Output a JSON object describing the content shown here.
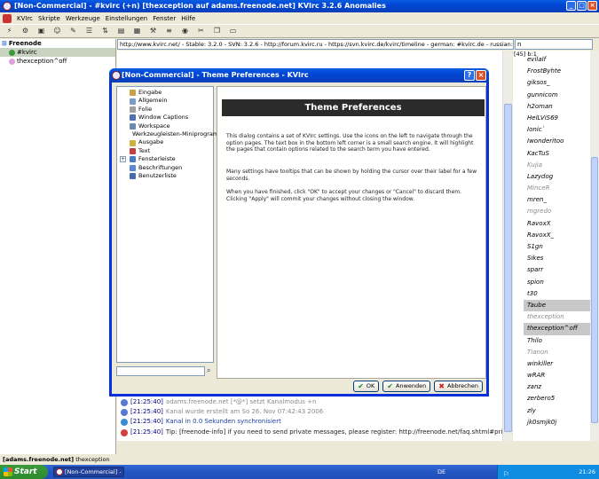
{
  "window": {
    "title": "[Non-Commercial] - #kvirc (+n) [thexception auf adams.freenode.net] KVIrc 3.2.6 Anomalies",
    "controls": [
      "_",
      "□",
      "×"
    ]
  },
  "menu": [
    "KVIrc",
    "Skripte",
    "Werkzeuge",
    "Einstellungen",
    "Fenster",
    "Hilfe"
  ],
  "tree": {
    "network": "Freenode",
    "channel": "#kvirc",
    "query": "thexception^off"
  },
  "topic": "http://www.kvirc.net/ - Stable: 3.2.0 - SVN: 3.2.6 - http://forum.kvirc.ru - https://svn.kvirc.de/kvirc/timeline - german: #kvirc.de - russian: #kvirc-ru - ital",
  "mode_field": "n",
  "user_count": "[45]",
  "user_count_suffix": "b:1",
  "users": [
    {
      "name": "evilalf",
      "style": "normal"
    },
    {
      "name": "FrostByhte",
      "style": "normal"
    },
    {
      "name": "giksos_",
      "style": "normal"
    },
    {
      "name": "gunnicom",
      "style": "normal"
    },
    {
      "name": "h2oman",
      "style": "normal"
    },
    {
      "name": "HelLViS69",
      "style": "normal"
    },
    {
      "name": "Ionic`",
      "style": "normal"
    },
    {
      "name": "Iwonderitoo",
      "style": "normal"
    },
    {
      "name": "KacTuS",
      "style": "normal"
    },
    {
      "name": "Kujia",
      "style": "grey"
    },
    {
      "name": "Lazydog",
      "style": "normal"
    },
    {
      "name": "MinceR",
      "style": "grey"
    },
    {
      "name": "mren_",
      "style": "normal"
    },
    {
      "name": "mgredo",
      "style": "grey"
    },
    {
      "name": "RavoxX",
      "style": "normal"
    },
    {
      "name": "RavoxX_",
      "style": "normal"
    },
    {
      "name": "S1gn",
      "style": "normal"
    },
    {
      "name": "Sikes",
      "style": "normal"
    },
    {
      "name": "sparr",
      "style": "normal"
    },
    {
      "name": "spion",
      "style": "normal"
    },
    {
      "name": "t30",
      "style": "normal"
    },
    {
      "name": "Taube",
      "style": "hl"
    },
    {
      "name": "thexception",
      "style": "grey"
    },
    {
      "name": "thexception^off",
      "style": "hl"
    },
    {
      "name": "Thilo",
      "style": "normal"
    },
    {
      "name": "Tianon",
      "style": "grey"
    },
    {
      "name": "winkiller",
      "style": "normal"
    },
    {
      "name": "wRAR",
      "style": "normal"
    },
    {
      "name": "zanz",
      "style": "normal"
    },
    {
      "name": "zerbero5",
      "style": "normal"
    },
    {
      "name": "zly",
      "style": "normal"
    },
    {
      "name": "jk0smjk0j",
      "style": "normal"
    }
  ],
  "chat_lines": [
    {
      "ts": "[21:25:40]",
      "msg": "adams.freenode.net [*@*] setzt Kanalmodus +n",
      "style": "grey",
      "icon_color": "#5a7ad0"
    },
    {
      "ts": "[21:25:40]",
      "msg": "Kanal wurde erstellt am So 26. Nov 07:42:43 2006",
      "style": "grey",
      "icon_color": "#5a7ad0"
    },
    {
      "ts": "[21:25:40]",
      "msg": "Kanal in 0.0 Sekunden synchronisiert",
      "style": "blue",
      "icon_color": "#3a8ad0"
    },
    {
      "ts": "[21:25:40]",
      "msg": "Tip: [freenode-info] if you need to send private messages, please register: http://freenode.net/faq.shtml#privmsg",
      "style": "blk",
      "icon_color": "#d04040"
    }
  ],
  "input_bar": {
    "server": "[adams.freenode.net]",
    "nick": "thexception"
  },
  "dialog": {
    "title": "[Non-Commercial] - Theme Preferences - KVIrc",
    "header": "Theme Preferences",
    "para1": "This dialog contains a set of KVIrc settings. Use the icons on the left to navigate through the option pages. The text box in the bottom left corner is a small search engine. It will highlight the pages that contain options related to the search term you have entered.",
    "para2": "Many settings have tooltips that can be shown by holding the cursor over their label for a few seconds.",
    "para3": "When you have finished, click \"OK\" to accept your changes or \"Cancel\" to discard them. Clicking \"Apply\" will commit your changes without closing the window.",
    "tree": [
      {
        "label": "Eingabe",
        "expandable": false,
        "color": "#c7a04a"
      },
      {
        "label": "Allgemein",
        "expandable": false,
        "color": "#7a9ac8"
      },
      {
        "label": "Folie",
        "expandable": false,
        "color": "#a0a0a0"
      },
      {
        "label": "Window Captions",
        "expandable": false,
        "color": "#5070b0"
      },
      {
        "label": "Workspace",
        "expandable": false,
        "color": "#6a8ab0"
      },
      {
        "label": "Werkzeugleisten-Miniprogramme",
        "expandable": false,
        "color": "#b08050"
      },
      {
        "label": "Ausgabe",
        "expandable": false,
        "color": "#d0b040"
      },
      {
        "label": "Text",
        "expandable": false,
        "color": "#c04040"
      },
      {
        "label": "Fensterleiste",
        "expandable": true,
        "color": "#4a7ac0"
      },
      {
        "label": "Beschriftungen",
        "expandable": false,
        "color": "#5a8ad0"
      },
      {
        "label": "Benutzerliste",
        "expandable": false,
        "color": "#4a6ab0"
      }
    ],
    "buttons": {
      "ok": "OK",
      "apply": "Anwenden",
      "cancel": "Abbrechen"
    }
  },
  "taskbar": {
    "start": "Start",
    "item": "[Non-Commercial] - #k...",
    "lang": "DE",
    "clock": "21:26"
  }
}
